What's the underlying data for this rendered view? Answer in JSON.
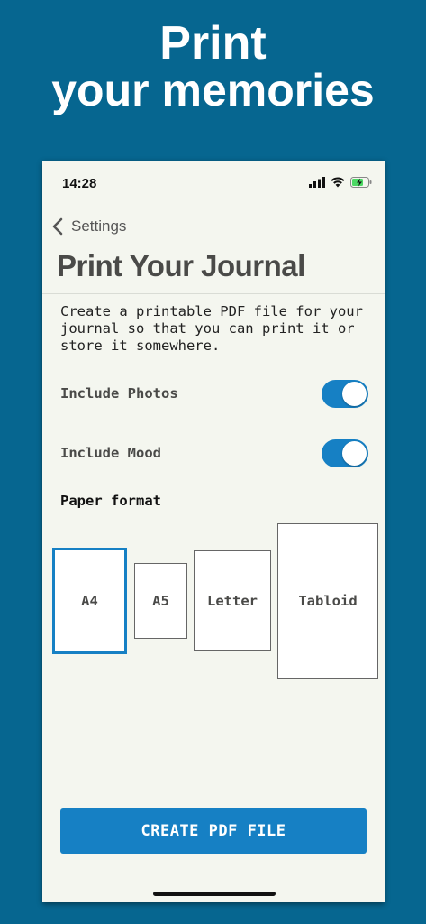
{
  "promo": {
    "line1": "Print",
    "line2": "your memories"
  },
  "status_bar": {
    "time": "14:28",
    "icons": [
      "signal-icon",
      "wifi-icon",
      "battery-charging-icon"
    ]
  },
  "nav": {
    "back_label": "Settings",
    "back_icon": "chevron-left-icon"
  },
  "page": {
    "title": "Print Your Journal",
    "description": "Create a printable PDF file for your journal so that you can print it or store it somewhere."
  },
  "options": [
    {
      "label": "Include Photos",
      "enabled": true
    },
    {
      "label": "Include Mood",
      "enabled": true
    }
  ],
  "paper_format": {
    "label": "Paper format",
    "formats": [
      "A4",
      "A5",
      "Letter",
      "Tabloid"
    ],
    "selected": "A4"
  },
  "actions": {
    "create_label": "CREATE PDF FILE"
  },
  "colors": {
    "background": "#066690",
    "accent": "#1680c4",
    "screen": "#f4f6ef"
  }
}
